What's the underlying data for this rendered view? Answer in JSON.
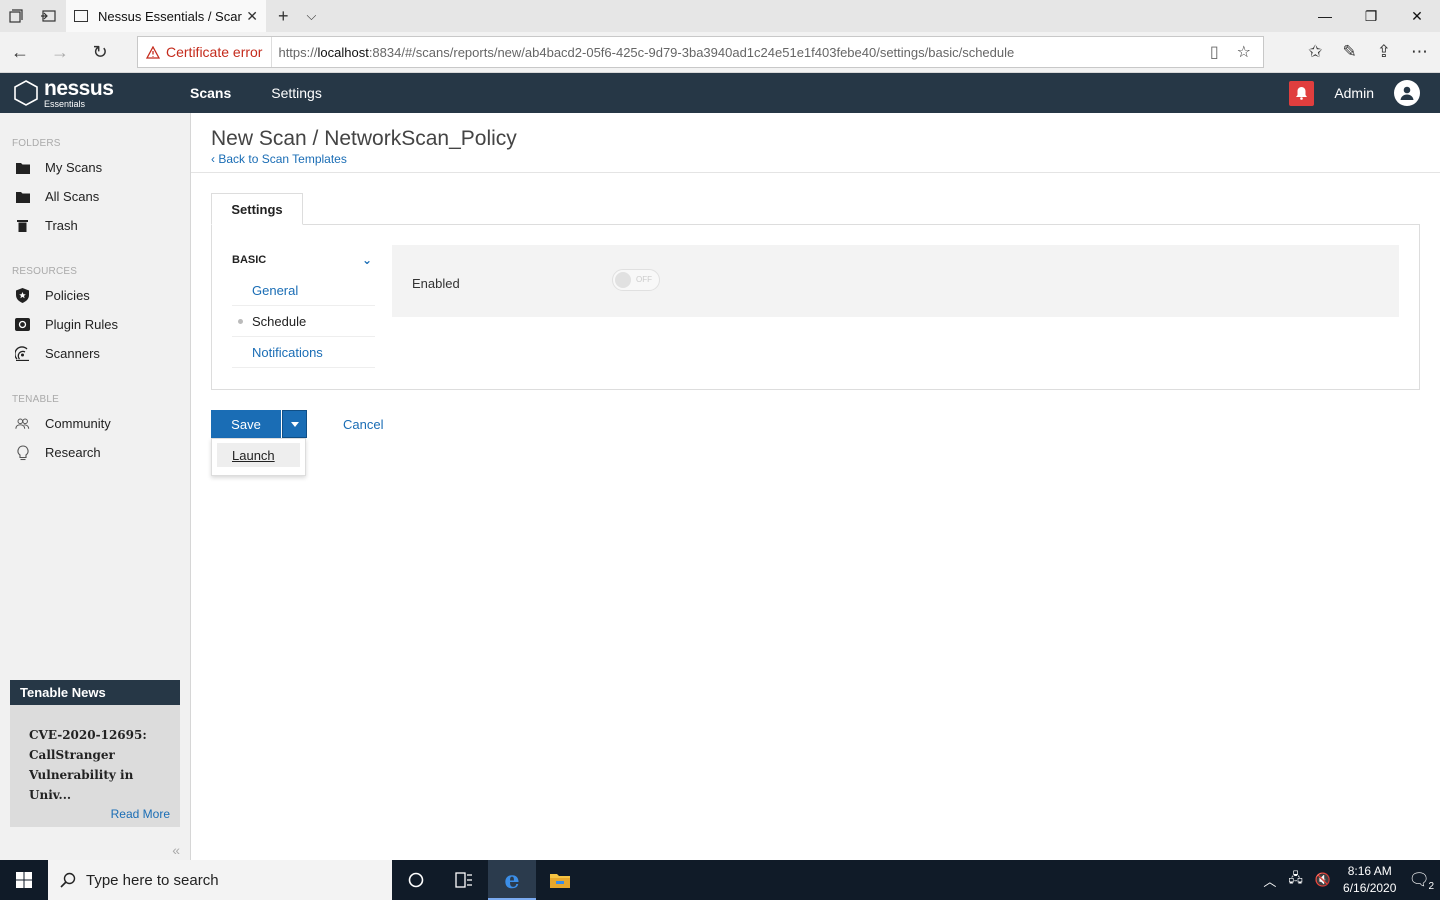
{
  "browser": {
    "tab_title": "Nessus Essentials / Scar",
    "cert_error": "Certificate error",
    "url_prefix": "https://",
    "url_host": "localhost",
    "url_rest": ":8834/#/scans/reports/new/ab4bacd2-05f6-425c-9d79-3ba3940ad1c24e51e1f403febe40/settings/basic/schedule"
  },
  "app": {
    "brand": "nessus",
    "brand_sub": "Essentials",
    "nav": {
      "scans": "Scans",
      "settings": "Settings"
    },
    "user": "Admin",
    "accent": "#1a6db5",
    "header_bg": "#263746",
    "alert_color": "#e03e3e"
  },
  "sidebar": {
    "folders_label": "FOLDERS",
    "folders": [
      "My Scans",
      "All Scans",
      "Trash"
    ],
    "resources_label": "RESOURCES",
    "resources": [
      "Policies",
      "Plugin Rules",
      "Scanners"
    ],
    "tenable_label": "TENABLE",
    "tenable": [
      "Community",
      "Research"
    ],
    "news": {
      "title": "Tenable News",
      "story": "CVE-2020-12695: CallStranger Vulnerability in Univ...",
      "read_more": "Read More"
    }
  },
  "main": {
    "title": "New Scan / NetworkScan_Policy",
    "back_link": "Back to Scan Templates",
    "tab": "Settings",
    "submenu": {
      "group": "BASIC",
      "items": [
        "General",
        "Schedule",
        "Notifications"
      ],
      "active": "Schedule"
    },
    "enabled_label": "Enabled",
    "toggle_state": "OFF",
    "save": "Save",
    "cancel": "Cancel",
    "dropdown_option": "Launch"
  },
  "taskbar": {
    "search_placeholder": "Type here to search",
    "time": "8:16 AM",
    "date": "6/16/2020",
    "notifications": "2"
  }
}
